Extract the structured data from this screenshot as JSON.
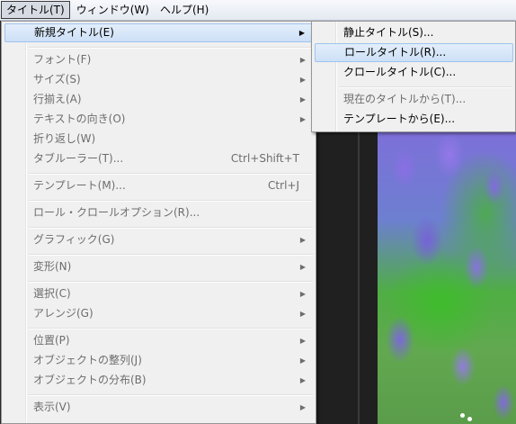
{
  "menubar": {
    "items": [
      {
        "label": "タイトル(T)"
      },
      {
        "label": "ウィンドウ(W)"
      },
      {
        "label": "ヘルプ(H)"
      }
    ]
  },
  "title_menu": {
    "items": [
      {
        "label": "新規タイトル(E)",
        "submenu": true,
        "highlighted": true
      },
      {
        "label": "フォント(F)",
        "submenu": true,
        "disabled": true
      },
      {
        "label": "サイズ(S)",
        "submenu": true,
        "disabled": true
      },
      {
        "label": "行揃え(A)",
        "submenu": true,
        "disabled": true
      },
      {
        "label": "テキストの向き(O)",
        "submenu": true,
        "disabled": true
      },
      {
        "label": "折り返し(W)",
        "disabled": true
      },
      {
        "label": "タブルーラー(T)...",
        "shortcut": "Ctrl+Shift+T",
        "disabled": true
      },
      {
        "label": "テンプレート(M)...",
        "shortcut": "Ctrl+J",
        "disabled": true
      },
      {
        "label": "ロール・クロールオプション(R)...",
        "disabled": true
      },
      {
        "label": "グラフィック(G)",
        "submenu": true,
        "disabled": true
      },
      {
        "label": "変形(N)",
        "submenu": true,
        "disabled": true
      },
      {
        "label": "選択(C)",
        "submenu": true,
        "disabled": true
      },
      {
        "label": "アレンジ(G)",
        "submenu": true,
        "disabled": true
      },
      {
        "label": "位置(P)",
        "submenu": true,
        "disabled": true
      },
      {
        "label": "オブジェクトの整列(J)",
        "submenu": true,
        "disabled": true
      },
      {
        "label": "オブジェクトの分布(B)",
        "submenu": true,
        "disabled": true
      },
      {
        "label": "表示(V)",
        "submenu": true,
        "disabled": true
      }
    ]
  },
  "new_title_submenu": {
    "items": [
      {
        "label": "静止タイトル(S)..."
      },
      {
        "label": "ロールタイトル(R)...",
        "highlighted": true
      },
      {
        "label": "クロールタイトル(C)..."
      },
      {
        "label": "現在のタイトルから(T)...",
        "disabled": true
      },
      {
        "label": "テンプレートから(E)..."
      }
    ]
  },
  "glyphs": {
    "submenu_arrow": "▶"
  }
}
